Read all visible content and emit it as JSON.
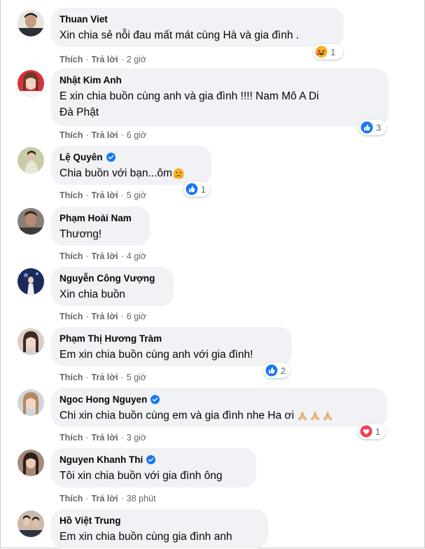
{
  "actions": {
    "like_label": "Thích",
    "reply_label": "Trả lời",
    "separator": "·"
  },
  "comments": [
    {
      "name": "Thuan Viet",
      "verified": false,
      "text": [
        "Xin chia sẻ nỗi đau mất mát cùng Hà và gia đình ."
      ],
      "time": "2 giờ",
      "reaction": {
        "icon": "haha-icon",
        "count": "1"
      }
    },
    {
      "name": "Nhật Kim Anh",
      "verified": false,
      "text": [
        "E xin chia buồn cùng anh và gia đình !!!! Nam Mô A Di",
        "Đà Phật"
      ],
      "time": "6 giờ",
      "reaction": {
        "icon": "like-icon",
        "count": "3"
      }
    },
    {
      "name": "Lệ Quyên",
      "verified": true,
      "text": [
        "Chia buồn với bạn...ôm"
      ],
      "time": "5 giờ",
      "reaction": {
        "icon": "like-icon",
        "count": "1"
      }
    },
    {
      "name": "Phạm Hoài Nam",
      "verified": false,
      "text": [
        "Thương!"
      ],
      "time": "4 giờ",
      "reaction": null
    },
    {
      "name": "Nguyễn Công Vượng",
      "verified": false,
      "text": [
        "Xin chia buồn"
      ],
      "time": "6 giờ",
      "reaction": null
    },
    {
      "name": "Phạm Thị Hương Tràm",
      "verified": false,
      "text": [
        "Em xin chia buồn cùng anh với gia đình!"
      ],
      "time": "5 giờ",
      "reaction": {
        "icon": "like-icon",
        "count": "2"
      }
    },
    {
      "name": "Ngoc Hong Nguyen",
      "verified": true,
      "text": [
        "Chi xin chia buồn cùng em và gia đình nhe Ha ơi"
      ],
      "time": "3 giờ",
      "reaction": {
        "icon": "love-icon",
        "count": "1"
      }
    },
    {
      "name": "Nguyen Khanh Thi",
      "verified": true,
      "text": [
        "Tôi xin chia buồn với gia đình ông"
      ],
      "time": "38 phút",
      "reaction": null
    },
    {
      "name": "Hồ Việt Trung",
      "verified": false,
      "text": [
        "Em xin chia buồn cùng gia đình anh"
      ],
      "time": "",
      "reaction": null
    }
  ],
  "colors": {
    "bubble": "#f0f2f5",
    "like_blue": "#1877f2",
    "love_red": "#f33e58",
    "haha_yellow": "#f7b125",
    "meta_gray": "#65676b"
  }
}
